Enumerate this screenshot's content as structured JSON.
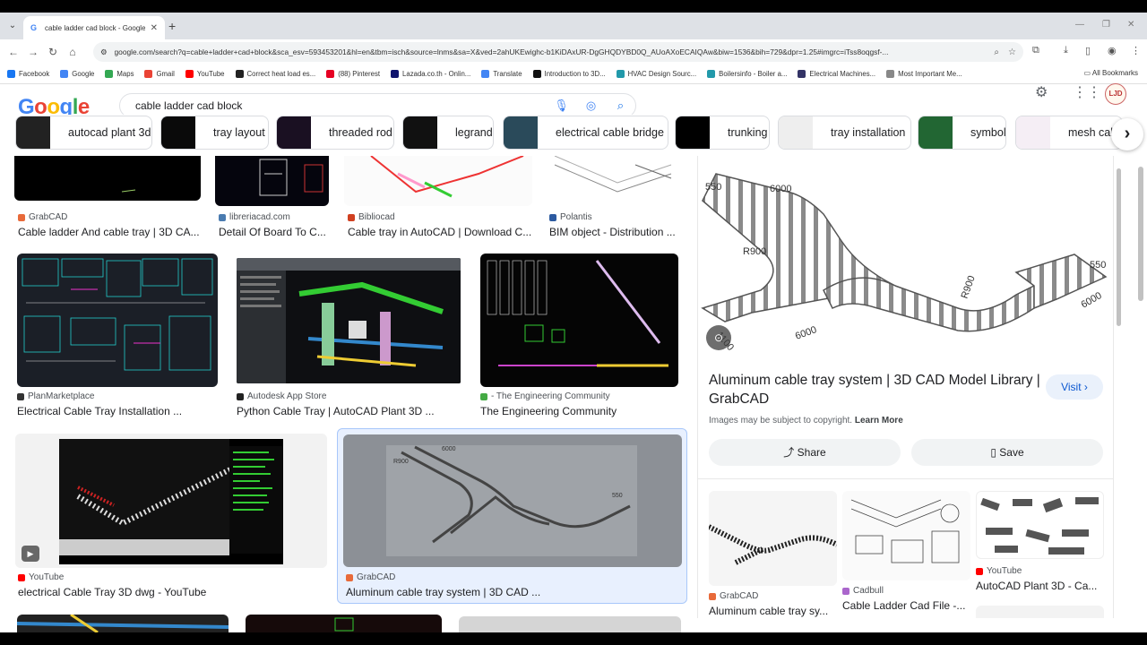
{
  "browser": {
    "tab_title": "cable ladder cad block - Google",
    "url": "google.com/search?q=cable+ladder+cad+block&sca_esv=593453201&hl=en&tbm=isch&source=lnms&sa=X&ved=2ahUKEwighc-b1KiDAxUR-DgGHQDYBD0Q_AUoAXoECAIQAw&biw=1536&bih=729&dpr=1.25#imgrc=iTss8oqgsf-...",
    "bookmarks": [
      "Facebook",
      "Google",
      "Maps",
      "Gmail",
      "YouTube",
      "Correct heat load es...",
      "(88) Pinterest",
      "Lazada.co.th - Onlin...",
      "Translate",
      "Introduction to 3D...",
      "HVAC Design Sourc...",
      "Boilersinfo - Boiler a...",
      "Electrical Machines...",
      "Most Important Me..."
    ],
    "all_bookmarks": "All Bookmarks"
  },
  "google": {
    "logo": "Google",
    "query": "cable ladder cad block",
    "avatar": "LJD"
  },
  "chips": [
    "autocad plant 3d",
    "tray layout",
    "threaded rod",
    "legrand",
    "electrical cable bridge",
    "trunking",
    "tray installation",
    "symbol",
    "mesh cable"
  ],
  "results": [
    {
      "source": "GrabCAD",
      "title": "Cable ladder And cable tray | 3D CA..."
    },
    {
      "source": "libreriacad.com",
      "title": "Detail Of Board To C..."
    },
    {
      "source": "Bibliocad",
      "title": "Cable tray in AutoCAD | Download C..."
    },
    {
      "source": "Polantis",
      "title": "BIM object - Distribution ..."
    },
    {
      "source": "PlanMarketplace",
      "title": "Electrical Cable Tray Installation ..."
    },
    {
      "source": "Autodesk App Store",
      "title": "Python Cable Tray | AutoCAD Plant 3D ..."
    },
    {
      "source": "- The Engineering Community",
      "title": "The Engineering Community"
    },
    {
      "source": "YouTube",
      "title": "electrical Cable Tray 3D dwg - YouTube"
    },
    {
      "source": "GrabCAD",
      "title": "Aluminum cable tray system | 3D CAD ..."
    }
  ],
  "panel": {
    "title": "Aluminum cable tray system | 3D CAD Model Library | GrabCAD",
    "visit": "Visit",
    "copyright": "Images may be subject to copyright.",
    "learn_more": "Learn More",
    "share": "Share",
    "save": "Save",
    "dims": [
      "550",
      "6000",
      "R900",
      "R900",
      "550",
      "6000",
      "6000",
      "1100"
    ],
    "related": [
      {
        "source": "GrabCAD",
        "title": "Aluminum cable tray sy..."
      },
      {
        "source": "Cadbull",
        "title": "Cable Ladder Cad File -..."
      },
      {
        "source": "YouTube",
        "title": "AutoCAD Plant 3D - Ca..."
      }
    ]
  },
  "colors": {
    "accent": "#1a73e8",
    "selected_bg": "#e8f0fe",
    "cad_black": "#000000"
  }
}
